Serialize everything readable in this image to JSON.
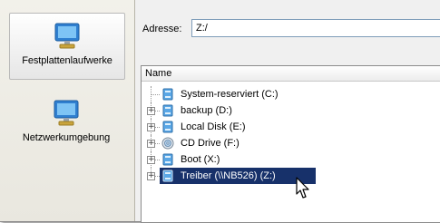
{
  "sidebar": {
    "items": [
      {
        "label": "Festplattenlaufwerke",
        "icon": "monitor-icon",
        "selected": true
      },
      {
        "label": "Netzwerkumgebung",
        "icon": "monitor-icon",
        "selected": false
      }
    ]
  },
  "address": {
    "label": "Adresse:",
    "value": "Z:/"
  },
  "tree": {
    "column_header": "Name",
    "items": [
      {
        "label": "System-reserviert (C:)",
        "icon": "drive-icon",
        "expandable": false,
        "selected": false
      },
      {
        "label": "backup (D:)",
        "icon": "drive-icon",
        "expandable": true,
        "selected": false
      },
      {
        "label": "Local Disk (E:)",
        "icon": "drive-icon",
        "expandable": true,
        "selected": false
      },
      {
        "label": "CD Drive (F:)",
        "icon": "cd-drive-icon",
        "expandable": true,
        "selected": false
      },
      {
        "label": "Boot (X:)",
        "icon": "drive-icon",
        "expandable": true,
        "selected": false
      },
      {
        "label": "Treiber (\\\\NB526) (Z:)",
        "icon": "drive-icon",
        "expandable": true,
        "selected": true
      }
    ]
  },
  "colors": {
    "selection": "#17316a",
    "accent": "#2a7fd4"
  }
}
